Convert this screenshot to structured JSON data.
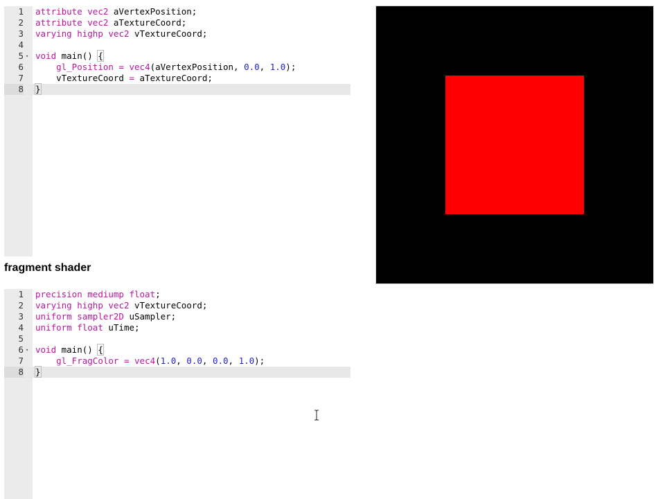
{
  "vertex_shader": {
    "lines": [
      {
        "num": "1",
        "fold": "",
        "tokens": [
          {
            "t": "attribute",
            "c": "kw"
          },
          {
            "t": " "
          },
          {
            "t": "vec2",
            "c": "kw"
          },
          {
            "t": " aVertexPosition;"
          }
        ]
      },
      {
        "num": "2",
        "fold": "",
        "tokens": [
          {
            "t": "attribute",
            "c": "kw"
          },
          {
            "t": " "
          },
          {
            "t": "vec2",
            "c": "kw"
          },
          {
            "t": " aTextureCoord;"
          }
        ]
      },
      {
        "num": "3",
        "fold": "",
        "tokens": [
          {
            "t": "varying",
            "c": "kw"
          },
          {
            "t": " "
          },
          {
            "t": "highp",
            "c": "kw"
          },
          {
            "t": " "
          },
          {
            "t": "vec2",
            "c": "kw"
          },
          {
            "t": " vTextureCoord;"
          }
        ]
      },
      {
        "num": "4",
        "fold": "",
        "tokens": []
      },
      {
        "num": "5",
        "fold": "▾",
        "tokens": [
          {
            "t": "void",
            "c": "kw"
          },
          {
            "t": " main() "
          },
          {
            "t": "{",
            "c": "brace"
          }
        ]
      },
      {
        "num": "6",
        "fold": "",
        "tokens": [
          {
            "t": "    "
          },
          {
            "t": "gl_Position",
            "c": "kw"
          },
          {
            "t": " "
          },
          {
            "t": "=",
            "c": "kw"
          },
          {
            "t": " "
          },
          {
            "t": "vec4",
            "c": "kw"
          },
          {
            "t": "(aVertexPosition, "
          },
          {
            "t": "0.0",
            "c": "num"
          },
          {
            "t": ", "
          },
          {
            "t": "1.0",
            "c": "num"
          },
          {
            "t": ");"
          }
        ]
      },
      {
        "num": "7",
        "fold": "",
        "tokens": [
          {
            "t": "    vTextureCoord "
          },
          {
            "t": "=",
            "c": "kw"
          },
          {
            "t": " aTextureCoord;"
          }
        ]
      },
      {
        "num": "8",
        "fold": "",
        "active": true,
        "tokens": [
          {
            "t": "}",
            "c": "brace"
          }
        ]
      }
    ]
  },
  "fragment_title": "fragment shader",
  "fragment_shader": {
    "lines": [
      {
        "num": "1",
        "fold": "",
        "tokens": [
          {
            "t": "precision",
            "c": "kw"
          },
          {
            "t": " "
          },
          {
            "t": "mediump",
            "c": "kw"
          },
          {
            "t": " "
          },
          {
            "t": "float",
            "c": "kw"
          },
          {
            "t": ";"
          }
        ]
      },
      {
        "num": "2",
        "fold": "",
        "tokens": [
          {
            "t": "varying",
            "c": "kw"
          },
          {
            "t": " "
          },
          {
            "t": "highp",
            "c": "kw"
          },
          {
            "t": " "
          },
          {
            "t": "vec2",
            "c": "kw"
          },
          {
            "t": " vTextureCoord;"
          }
        ]
      },
      {
        "num": "3",
        "fold": "",
        "tokens": [
          {
            "t": "uniform",
            "c": "kw"
          },
          {
            "t": " "
          },
          {
            "t": "sampler2D",
            "c": "kw"
          },
          {
            "t": " uSampler;"
          }
        ]
      },
      {
        "num": "4",
        "fold": "",
        "tokens": [
          {
            "t": "uniform",
            "c": "kw"
          },
          {
            "t": " "
          },
          {
            "t": "float",
            "c": "kw"
          },
          {
            "t": " uTime;"
          }
        ]
      },
      {
        "num": "5",
        "fold": "",
        "tokens": []
      },
      {
        "num": "6",
        "fold": "▾",
        "tokens": [
          {
            "t": "void",
            "c": "kw"
          },
          {
            "t": " main() "
          },
          {
            "t": "{",
            "c": "brace"
          }
        ]
      },
      {
        "num": "7",
        "fold": "",
        "tokens": [
          {
            "t": "    "
          },
          {
            "t": "gl_FragColor",
            "c": "kw"
          },
          {
            "t": " "
          },
          {
            "t": "=",
            "c": "kw"
          },
          {
            "t": " "
          },
          {
            "t": "vec4",
            "c": "kw"
          },
          {
            "t": "("
          },
          {
            "t": "1.0",
            "c": "num"
          },
          {
            "t": ", "
          },
          {
            "t": "0.0",
            "c": "num"
          },
          {
            "t": ", "
          },
          {
            "t": "0.0",
            "c": "num"
          },
          {
            "t": ", "
          },
          {
            "t": "1.0",
            "c": "num"
          },
          {
            "t": ");"
          }
        ]
      },
      {
        "num": "8",
        "fold": "",
        "active": true,
        "tokens": [
          {
            "t": "}",
            "c": "brace"
          }
        ]
      }
    ]
  },
  "preview": {
    "background": "#000000",
    "quad_color": "#ff0000"
  },
  "icons": {
    "cursor": "text-cursor-icon",
    "fold": "fold-arrow-icon"
  }
}
